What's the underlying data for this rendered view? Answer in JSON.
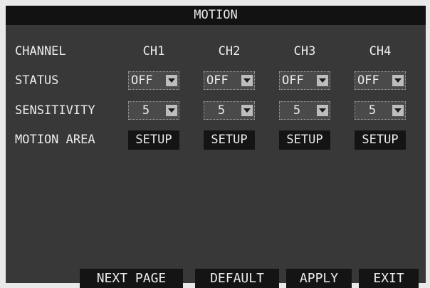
{
  "title": "MOTION",
  "rows": {
    "channel": "CHANNEL",
    "status": "STATUS",
    "sensitivity": "SENSITIVITY",
    "motion_area": "MOTION AREA"
  },
  "channels": [
    {
      "name": "CH1",
      "status": "OFF",
      "sensitivity": "5",
      "motion_area": "SETUP"
    },
    {
      "name": "CH2",
      "status": "OFF",
      "sensitivity": "5",
      "motion_area": "SETUP"
    },
    {
      "name": "CH3",
      "status": "OFF",
      "sensitivity": "5",
      "motion_area": "SETUP"
    },
    {
      "name": "CH4",
      "status": "OFF",
      "sensitivity": "5",
      "motion_area": "SETUP"
    }
  ],
  "footer": {
    "next_page": "NEXT PAGE",
    "default": "DEFAULT",
    "apply": "APPLY",
    "exit": "EXIT"
  },
  "colors": {
    "background": "#383838",
    "titlebar": "#121212",
    "button": "#141414",
    "text": "#ececec"
  }
}
